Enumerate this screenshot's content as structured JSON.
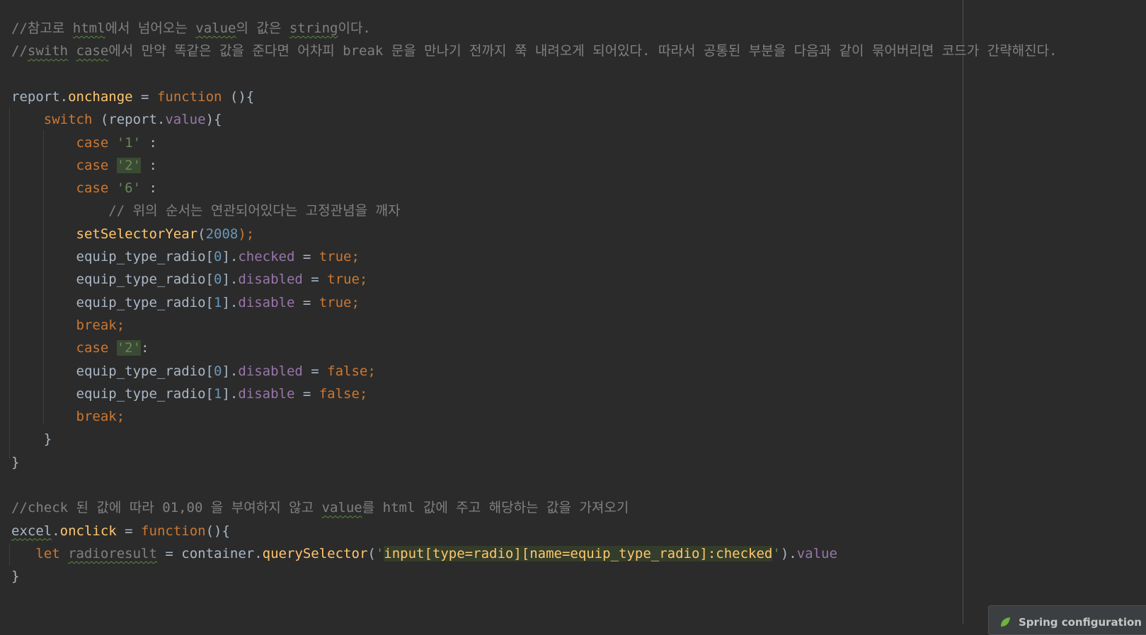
{
  "lines": [
    {
      "tokens": [
        {
          "t": "//참고로 ",
          "c": "tok-comment"
        },
        {
          "t": "html",
          "c": "tok-comment squiggle"
        },
        {
          "t": "에서 넘어오는 ",
          "c": "tok-comment"
        },
        {
          "t": "value",
          "c": "tok-comment squiggle"
        },
        {
          "t": "의 값은 ",
          "c": "tok-comment"
        },
        {
          "t": "string",
          "c": "tok-comment squiggle"
        },
        {
          "t": "이다.",
          "c": "tok-comment"
        }
      ]
    },
    {
      "tokens": [
        {
          "t": "//",
          "c": "tok-comment"
        },
        {
          "t": "swith",
          "c": "tok-comment squiggle"
        },
        {
          "t": " ",
          "c": "tok-comment"
        },
        {
          "t": "case",
          "c": "tok-comment squiggle"
        },
        {
          "t": "에서 만약 똑같은 값을 준다면 어차피 break 문을 만나기 전까지 쭉 내려오게 되어있다. 따라서 공통된 부분을 다음과 같이 묶어버리면 코드가 간략해진다.",
          "c": "tok-comment"
        }
      ]
    },
    {
      "tokens": []
    },
    {
      "tokens": [
        {
          "t": "report",
          "c": "tok-plain"
        },
        {
          "t": ".",
          "c": "tok-plain"
        },
        {
          "t": "onchange",
          "c": "tok-fn"
        },
        {
          "t": " = ",
          "c": "tok-plain"
        },
        {
          "t": "function",
          "c": "tok-kw"
        },
        {
          "t": " (){",
          "c": "tok-plain"
        }
      ]
    },
    {
      "tokens": [
        {
          "t": "    ",
          "c": "tok-plain"
        },
        {
          "t": "switch",
          "c": "tok-kw"
        },
        {
          "t": " (report.",
          "c": "tok-plain"
        },
        {
          "t": "value",
          "c": "tok-prop"
        },
        {
          "t": "){",
          "c": "tok-plain"
        }
      ]
    },
    {
      "tokens": [
        {
          "t": "        ",
          "c": "tok-plain"
        },
        {
          "t": "case",
          "c": "tok-kw"
        },
        {
          "t": " ",
          "c": "tok-plain"
        },
        {
          "t": "'1'",
          "c": "tok-str"
        },
        {
          "t": " :",
          "c": "tok-plain"
        }
      ]
    },
    {
      "tokens": [
        {
          "t": "        ",
          "c": "tok-plain"
        },
        {
          "t": "case",
          "c": "tok-kw"
        },
        {
          "t": " ",
          "c": "tok-plain"
        },
        {
          "t": "'2'",
          "c": "tok-str hl-match"
        },
        {
          "t": " :",
          "c": "tok-plain"
        }
      ]
    },
    {
      "tokens": [
        {
          "t": "        ",
          "c": "tok-plain"
        },
        {
          "t": "case",
          "c": "tok-kw"
        },
        {
          "t": " ",
          "c": "tok-plain"
        },
        {
          "t": "'6'",
          "c": "tok-str"
        },
        {
          "t": " :",
          "c": "tok-plain"
        }
      ]
    },
    {
      "tokens": [
        {
          "t": "            ",
          "c": "tok-plain"
        },
        {
          "t": "// 위의 순서는 연관되어있다는 고정관념을 깨자",
          "c": "tok-comment"
        }
      ]
    },
    {
      "tokens": [
        {
          "t": "        ",
          "c": "tok-plain"
        },
        {
          "t": "setSelectorYear",
          "c": "tok-fn"
        },
        {
          "t": "(",
          "c": "tok-plain"
        },
        {
          "t": "2008",
          "c": "tok-num"
        },
        {
          "t": ");",
          "c": "tok-kw"
        }
      ]
    },
    {
      "tokens": [
        {
          "t": "        ",
          "c": "tok-plain"
        },
        {
          "t": "equip_type_radio[",
          "c": "tok-plain"
        },
        {
          "t": "0",
          "c": "tok-num"
        },
        {
          "t": "].",
          "c": "tok-plain"
        },
        {
          "t": "checked",
          "c": "tok-prop"
        },
        {
          "t": " = ",
          "c": "tok-plain"
        },
        {
          "t": "true;",
          "c": "tok-kw"
        }
      ]
    },
    {
      "tokens": [
        {
          "t": "        ",
          "c": "tok-plain"
        },
        {
          "t": "equip_type_radio[",
          "c": "tok-plain"
        },
        {
          "t": "0",
          "c": "tok-num"
        },
        {
          "t": "].",
          "c": "tok-plain"
        },
        {
          "t": "disabled",
          "c": "tok-prop"
        },
        {
          "t": " = ",
          "c": "tok-plain"
        },
        {
          "t": "true;",
          "c": "tok-kw"
        }
      ]
    },
    {
      "tokens": [
        {
          "t": "        ",
          "c": "tok-plain"
        },
        {
          "t": "equip_type_radio[",
          "c": "tok-plain"
        },
        {
          "t": "1",
          "c": "tok-num"
        },
        {
          "t": "].",
          "c": "tok-plain"
        },
        {
          "t": "disable",
          "c": "tok-prop"
        },
        {
          "t": " = ",
          "c": "tok-plain"
        },
        {
          "t": "true;",
          "c": "tok-kw"
        }
      ]
    },
    {
      "tokens": [
        {
          "t": "        ",
          "c": "tok-plain"
        },
        {
          "t": "break;",
          "c": "tok-kw"
        }
      ]
    },
    {
      "tokens": [
        {
          "t": "        ",
          "c": "tok-plain"
        },
        {
          "t": "case",
          "c": "tok-kw"
        },
        {
          "t": " ",
          "c": "tok-plain"
        },
        {
          "t": "'2'",
          "c": "tok-str hl-match"
        },
        {
          "t": ":",
          "c": "tok-plain"
        }
      ]
    },
    {
      "tokens": [
        {
          "t": "        ",
          "c": "tok-plain"
        },
        {
          "t": "equip_type_radio[",
          "c": "tok-plain"
        },
        {
          "t": "0",
          "c": "tok-num"
        },
        {
          "t": "].",
          "c": "tok-plain"
        },
        {
          "t": "disabled",
          "c": "tok-prop"
        },
        {
          "t": " = ",
          "c": "tok-plain"
        },
        {
          "t": "false;",
          "c": "tok-kw"
        }
      ]
    },
    {
      "tokens": [
        {
          "t": "        ",
          "c": "tok-plain"
        },
        {
          "t": "equip_type_radio[",
          "c": "tok-plain"
        },
        {
          "t": "1",
          "c": "tok-num"
        },
        {
          "t": "].",
          "c": "tok-plain"
        },
        {
          "t": "disable",
          "c": "tok-prop"
        },
        {
          "t": " = ",
          "c": "tok-plain"
        },
        {
          "t": "false;",
          "c": "tok-kw"
        }
      ]
    },
    {
      "tokens": [
        {
          "t": "        ",
          "c": "tok-plain"
        },
        {
          "t": "break;",
          "c": "tok-kw"
        }
      ]
    },
    {
      "tokens": [
        {
          "t": "    }",
          "c": "tok-plain"
        }
      ]
    },
    {
      "tokens": [
        {
          "t": "}",
          "c": "tok-plain"
        }
      ]
    },
    {
      "tokens": []
    },
    {
      "tokens": [
        {
          "t": "//check 된 값에 따라 01,00 을 부여하지 않고 ",
          "c": "tok-comment"
        },
        {
          "t": "value",
          "c": "tok-comment squiggle"
        },
        {
          "t": "를 html 값에 주고 해당하는 값을 가져오기",
          "c": "tok-comment"
        }
      ]
    },
    {
      "tokens": [
        {
          "t": "excel",
          "c": "tok-plain squiggle"
        },
        {
          "t": ".",
          "c": "tok-plain"
        },
        {
          "t": "onclick",
          "c": "tok-fn"
        },
        {
          "t": " = ",
          "c": "tok-plain"
        },
        {
          "t": "function",
          "c": "tok-kw"
        },
        {
          "t": "(){",
          "c": "tok-plain"
        }
      ]
    },
    {
      "tokens": [
        {
          "t": "   ",
          "c": "tok-plain"
        },
        {
          "t": "let",
          "c": "tok-kw"
        },
        {
          "t": " ",
          "c": "tok-plain"
        },
        {
          "t": "radioresult",
          "c": "tok-comment squiggle"
        },
        {
          "t": " = container.",
          "c": "tok-plain"
        },
        {
          "t": "querySelector",
          "c": "tok-fn"
        },
        {
          "t": "(",
          "c": "tok-plain"
        },
        {
          "t": "'",
          "c": "tok-str"
        },
        {
          "t": "input[type=radio][name=equip_type_radio]:checked",
          "c": "tok-fn hl-inject"
        },
        {
          "t": "'",
          "c": "tok-str"
        },
        {
          "t": ").",
          "c": "tok-plain"
        },
        {
          "t": "value",
          "c": "tok-prop"
        }
      ]
    },
    {
      "tokens": [
        {
          "t": "}",
          "c": "tok-plain"
        }
      ]
    }
  ],
  "notification": {
    "text": "Spring configuration",
    "icon": "spring-leaf-icon"
  }
}
